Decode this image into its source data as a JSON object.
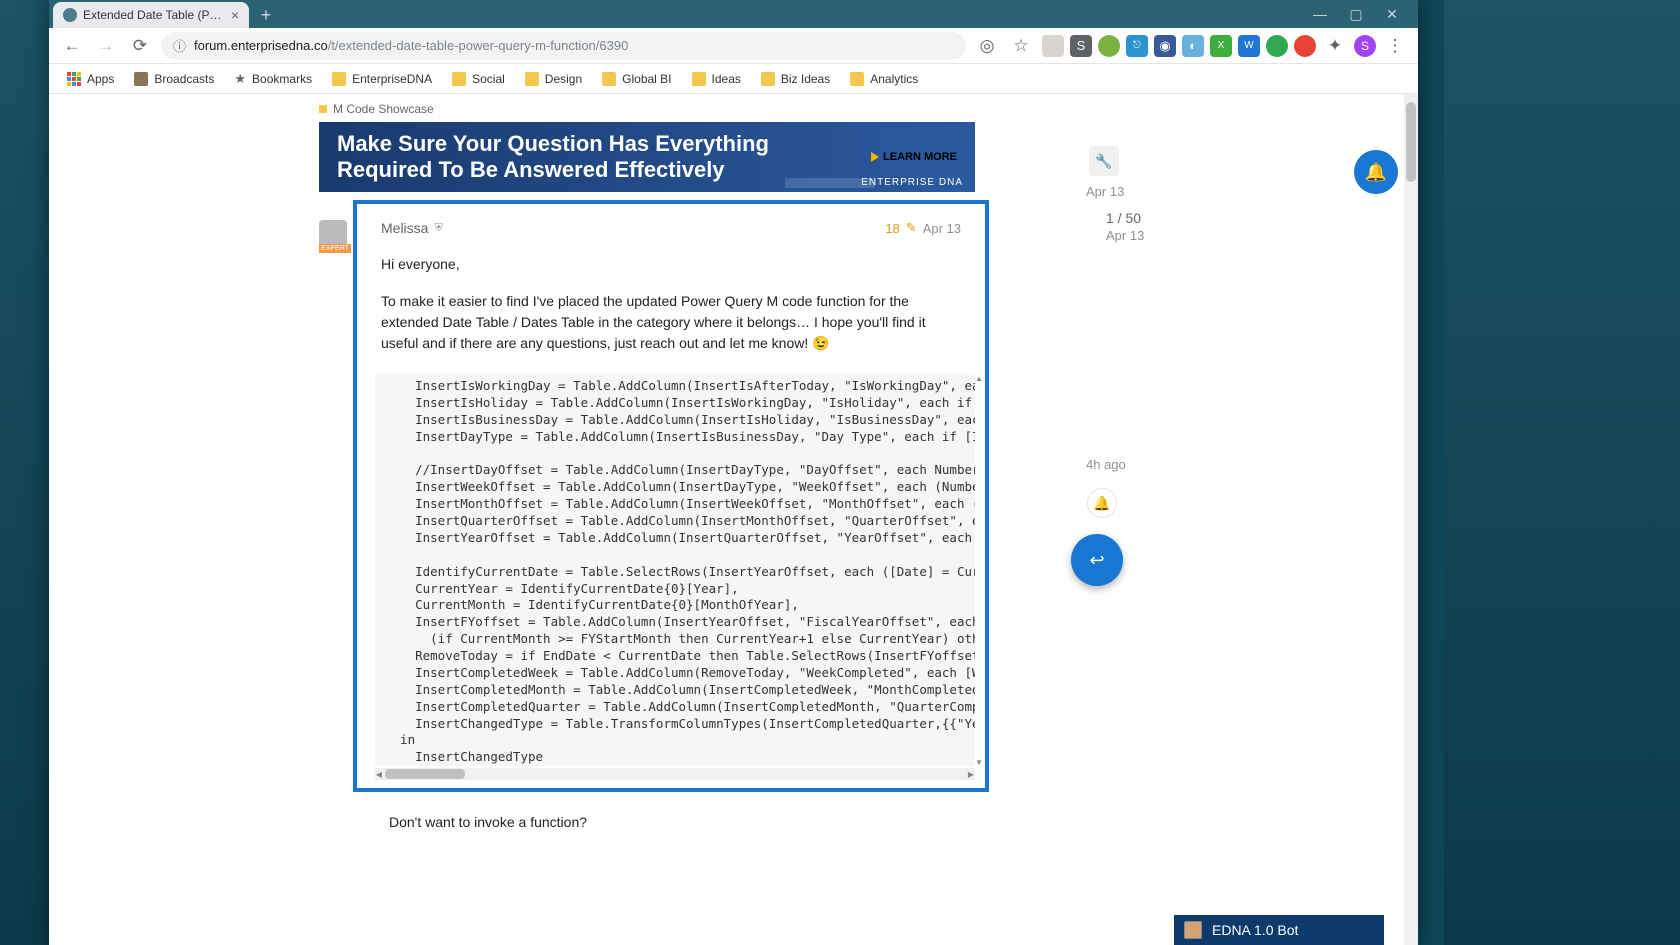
{
  "browser": {
    "tab_title": "Extended Date Table (Power Qu…",
    "url_domain": "forum.enterprisedna.co",
    "url_path": "/t/extended-date-table-power-query-m-function/6390",
    "window_controls": {
      "minimize": "—",
      "maximize": "▢",
      "close": "✕"
    },
    "nav": {
      "back": "←",
      "forward": "→",
      "reload": "⟳"
    },
    "url_lock": "ⓘ",
    "actions": {
      "view_site": "◎",
      "star": "☆",
      "menu": "⋮",
      "extensions": "✦"
    },
    "profile_initial": "S"
  },
  "bookmarks": {
    "apps": "Apps",
    "items": [
      "Broadcasts",
      "Bookmarks",
      "EnterpriseDNA",
      "Social",
      "Design",
      "Global BI",
      "Ideas",
      "Biz Ideas",
      "Analytics"
    ]
  },
  "forum": {
    "category": "M Code Showcase",
    "banner": {
      "line1": "Make Sure Your Question Has Everything",
      "line2": "Required To Be Answered Effectively",
      "cta": "LEARN MORE",
      "brand": "ENTERPRISE DNA"
    },
    "post": {
      "author": "Melissa",
      "edit_count": "18",
      "date": "Apr 13",
      "body1": "Hi everyone,",
      "body2": "To make it easier to find I've placed the updated Power Query M code function for the extended Date Table / Dates Table in the category where it belongs… I hope you'll find it useful and if there are any questions, just reach out and let me know! 😉"
    },
    "code": "    InsertIsWorkingDay = Table.AddColumn(InsertIsAfterToday, \"IsWorkingDay\", each\n    InsertIsHoliday = Table.AddColumn(InsertIsWorkingDay, \"IsHoliday\", each if Ho\n    InsertIsBusinessDay = Table.AddColumn(InsertIsHoliday, \"IsBusinessDay\", each\n    InsertDayType = Table.AddColumn(InsertIsBusinessDay, \"Day Type\", each if [IsH\n\n    //InsertDayOffset = Table.AddColumn(InsertDayType, \"DayOffset\", each Number.F\n    InsertWeekOffset = Table.AddColumn(InsertDayType, \"WeekOffset\", each (Number.\n    InsertMonthOffset = Table.AddColumn(InsertWeekOffset, \"MonthOffset\", each ((1\n    InsertQuarterOffset = Table.AddColumn(InsertMonthOffset, \"QuarterOffset\", eac\n    InsertYearOffset = Table.AddColumn(InsertQuarterOffset, \"YearOffset\", each Da\n\n    IdentifyCurrentDate = Table.SelectRows(InsertYearOffset, each ([Date] = Curre\n    CurrentYear = IdentifyCurrentDate{0}[Year],\n    CurrentMonth = IdentifyCurrentDate{0}[MonthOfYear],\n    InsertFYoffset = Table.AddColumn(InsertYearOffset, \"FiscalYearOffset\", each t\n      (if CurrentMonth >= FYStartMonth then CurrentYear+1 else CurrentYear) other\n    RemoveToday = if EndDate < CurrentDate then Table.SelectRows(InsertFYoffset,\n    InsertCompletedWeek = Table.AddColumn(RemoveToday, \"WeekCompleted\", each [Wee\n    InsertCompletedMonth = Table.AddColumn(InsertCompletedWeek, \"MonthCompleted\",\n    InsertCompletedQuarter = Table.AddColumn(InsertCompletedMonth, \"QuarterComple\n    InsertChangedType = Table.TransformColumnTypes(InsertCompletedQuarter,{{\"Year\n  in\n    InsertChangedType\nin",
    "followup": "Don't want to invoke a function?",
    "avatar_badge": "EXPERT"
  },
  "timeline": {
    "top_date": "Apr 13",
    "counter": "1 / 50",
    "counter_date": "Apr 13",
    "bottom_date": "4h ago"
  },
  "chat": {
    "title": "EDNA 1.0 Bot"
  }
}
